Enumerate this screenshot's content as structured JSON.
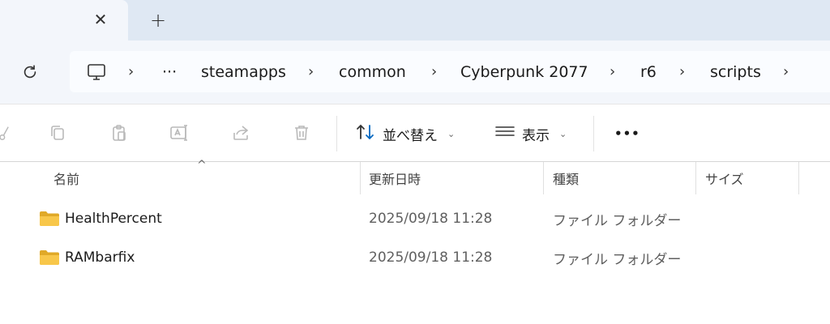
{
  "tabs": {
    "close_glyph": "✕",
    "new_tab_glyph": "+"
  },
  "address": {
    "overflow": "···",
    "separator": "›",
    "crumbs": [
      "steamapps",
      "common",
      "Cyberpunk 2077",
      "r6",
      "scripts"
    ]
  },
  "toolbar": {
    "sort_label": "並べ替え",
    "view_label": "表示",
    "more_glyph": "•••"
  },
  "columns": {
    "name": "名前",
    "date": "更新日時",
    "type": "種類",
    "size": "サイズ"
  },
  "files": [
    {
      "name": "HealthPercent",
      "date": "2025/09/18 11:28",
      "type": "ファイル フォルダー",
      "size": ""
    },
    {
      "name": "RAMbarfix",
      "date": "2025/09/18 11:28",
      "type": "ファイル フォルダー",
      "size": ""
    }
  ],
  "colors": {
    "folder": "#f8c74a",
    "folder_dark": "#e0a928",
    "accent": "#0067c0"
  },
  "icons": [
    "cut-icon",
    "copy-icon",
    "paste-icon",
    "rename-icon",
    "share-icon",
    "delete-icon",
    "sort-icon",
    "view-icon",
    "more-icon",
    "refresh-icon",
    "this-pc-icon",
    "folder-icon"
  ]
}
